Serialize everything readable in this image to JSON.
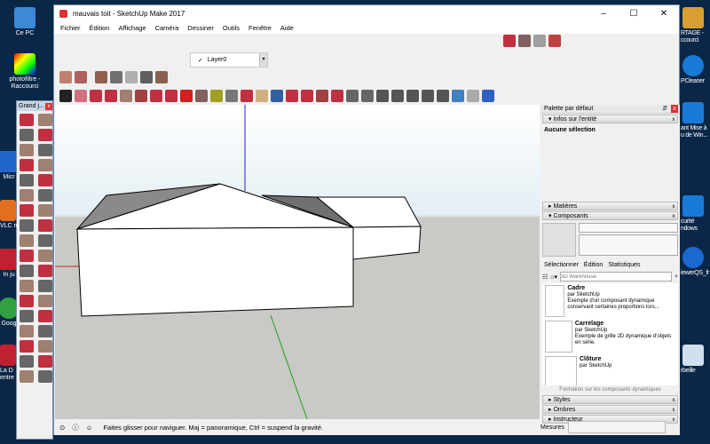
{
  "desktop": {
    "left_icons": [
      "Ce PC",
      "photofiltre - Raccourci",
      "Micr",
      "VLC m",
      "In ju",
      "Goog",
      "La D entre"
    ],
    "right_icons": [
      "RTAGE - ccourci",
      "PCleaner",
      "ant Mise à u de Win...",
      "curité ndows",
      "iewerQS_fr",
      "rbeille"
    ]
  },
  "window": {
    "title": "mauvais toit - SketchUp Make 2017",
    "min": "–",
    "max": "☐",
    "close": "✕"
  },
  "menu": [
    "Fichier",
    "Édition",
    "Affichage",
    "Caméra",
    "Dessiner",
    "Outils",
    "Fenêtre",
    "Aide"
  ],
  "layer": {
    "check": "✓",
    "name": "Layer0",
    "dropdown": "▾"
  },
  "grand_jeu": {
    "title": "Grand j...",
    "close": "x"
  },
  "status": {
    "text": "Faites glisser pour naviguer. Maj = panoramique, Ctrl =  suspend la gravité.",
    "measures_label": "Mesures"
  },
  "panel": {
    "title": "Palette par défaut",
    "pin": "⇵",
    "close": "x",
    "entity": {
      "header": "Infos sur l'entité",
      "value": "Aucune sélection"
    },
    "materials": "Matières",
    "components": "Composants",
    "tabs": [
      "Sélectionner",
      "Édition",
      "Statistiques"
    ],
    "search_placeholder": "3D Warehouse",
    "items": [
      {
        "name": "Cadre",
        "author": "par SketchUp",
        "desc": "Exemple d'un composant dynamique conservant certaines proportions lors..."
      },
      {
        "name": "Carrelage",
        "author": "par SketchUp",
        "desc": "Exemple de grille 2D dynamique d'objets en série."
      },
      {
        "name": "Clôture",
        "author": "par SketchUp",
        "desc": ""
      }
    ],
    "training": "Formation sur les composants dynamiques",
    "styles": "Styles",
    "shadows": "Ombres",
    "instructor": "Instructeur"
  },
  "colors": {
    "desktop": "#0b2747",
    "sky": "#e4eef4",
    "ground": "#c9c9c5",
    "axis_red": "#d02020",
    "axis_green": "#20a020",
    "axis_blue": "#2020d0",
    "tool_red": "#c0303a"
  }
}
